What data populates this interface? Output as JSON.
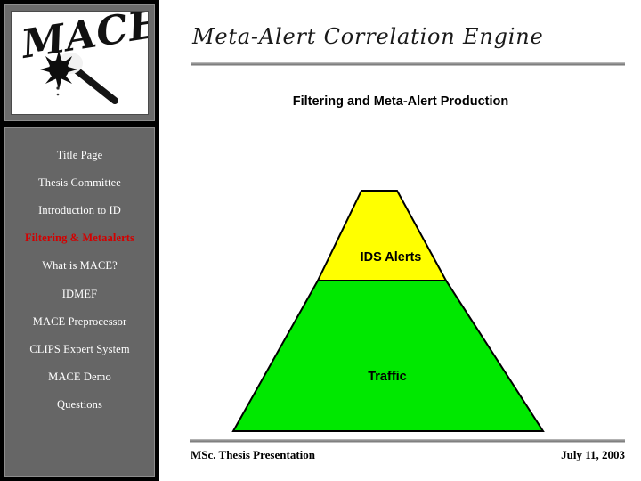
{
  "slide": {
    "header_title": "Meta-Alert Correlation Engine",
    "subtitle": "Filtering and Meta-Alert Production"
  },
  "logo": {
    "alt": "MACE",
    "wordmark": "MACE",
    "icon": "mace-weapon-icon"
  },
  "sidebar": {
    "items": [
      {
        "label": "Title Page",
        "active": false
      },
      {
        "label": "Thesis Committee",
        "active": false
      },
      {
        "label": "Introduction to ID",
        "active": false
      },
      {
        "label": "Filtering & Metaalerts",
        "active": true
      },
      {
        "label": "What is MACE?",
        "active": false
      },
      {
        "label": "IDMEF",
        "active": false
      },
      {
        "label": "MACE Preprocessor",
        "active": false
      },
      {
        "label": "CLIPS Expert System",
        "active": false
      },
      {
        "label": "MACE Demo",
        "active": false
      },
      {
        "label": "Questions",
        "active": false
      }
    ],
    "active_color": "#d40000",
    "text_color": "#ffffff",
    "panel_color": "#666666"
  },
  "diagram": {
    "type": "pyramid",
    "name": "traffic-to-alerts-pyramid",
    "layers": [
      {
        "label": "IDS Alerts",
        "color": "#ffff00",
        "position": "top"
      },
      {
        "label": "Traffic",
        "color": "#00e800",
        "position": "bottom"
      }
    ],
    "stroke": "#000000"
  },
  "footer": {
    "left": "MSc. Thesis Presentation",
    "right": "July 11, 2003"
  }
}
